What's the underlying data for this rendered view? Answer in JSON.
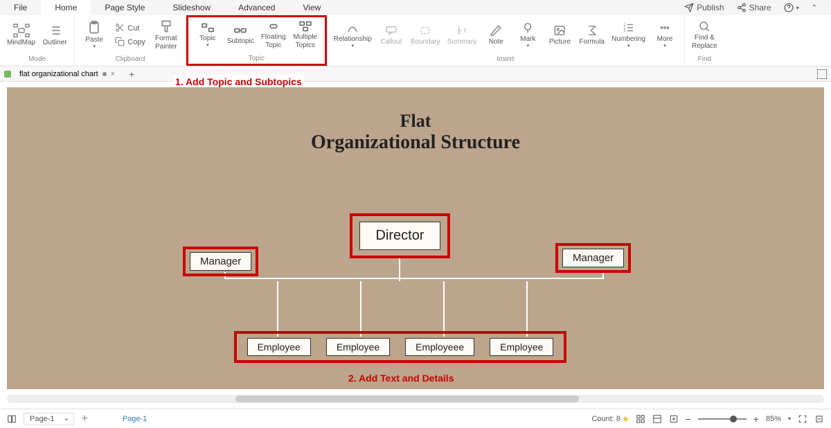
{
  "menu": {
    "file": "File",
    "home": "Home",
    "page_style": "Page Style",
    "slideshow": "Slideshow",
    "advanced": "Advanced",
    "view": "View",
    "publish": "Publish",
    "share": "Share"
  },
  "ribbon": {
    "mode": {
      "label": "Mode",
      "mindmap": "MindMap",
      "outliner": "Outliner"
    },
    "clipboard": {
      "label": "Clipboard",
      "paste": "Paste",
      "cut": "Cut",
      "copy": "Copy",
      "format_painter": "Format\nPainter"
    },
    "topic": {
      "label": "Topic",
      "topic_btn": "Topic",
      "subtopic": "Subtopic",
      "floating": "Floating\nTopic",
      "multiple": "Multiple\nTopics"
    },
    "insert": {
      "label": "Insert",
      "relationship": "Relationship",
      "callout": "Callout",
      "boundary": "Boundary",
      "summary": "Summary",
      "note": "Note",
      "mark": "Mark",
      "picture": "Picture",
      "formula": "Formula",
      "numbering": "Numbering",
      "more": "More"
    },
    "find": {
      "label": "Find",
      "find_replace": "Find &\nReplace"
    }
  },
  "tab": {
    "name": "flat organizational chart"
  },
  "annotations": {
    "ann1": "1. Add Topic and Subtopics",
    "ann2": "2. Add Text and Details"
  },
  "chart": {
    "title1": "Flat",
    "title2": "Organizational Structure",
    "director": "Director",
    "manager_left": "Manager",
    "manager_right": "Manager",
    "employees": [
      "Employee",
      "Employee",
      "Employeee",
      "Employee"
    ]
  },
  "status": {
    "page_sel": "Page-1",
    "page_lbl": "Page-1",
    "count": "Count: 8",
    "zoom": "85%"
  }
}
